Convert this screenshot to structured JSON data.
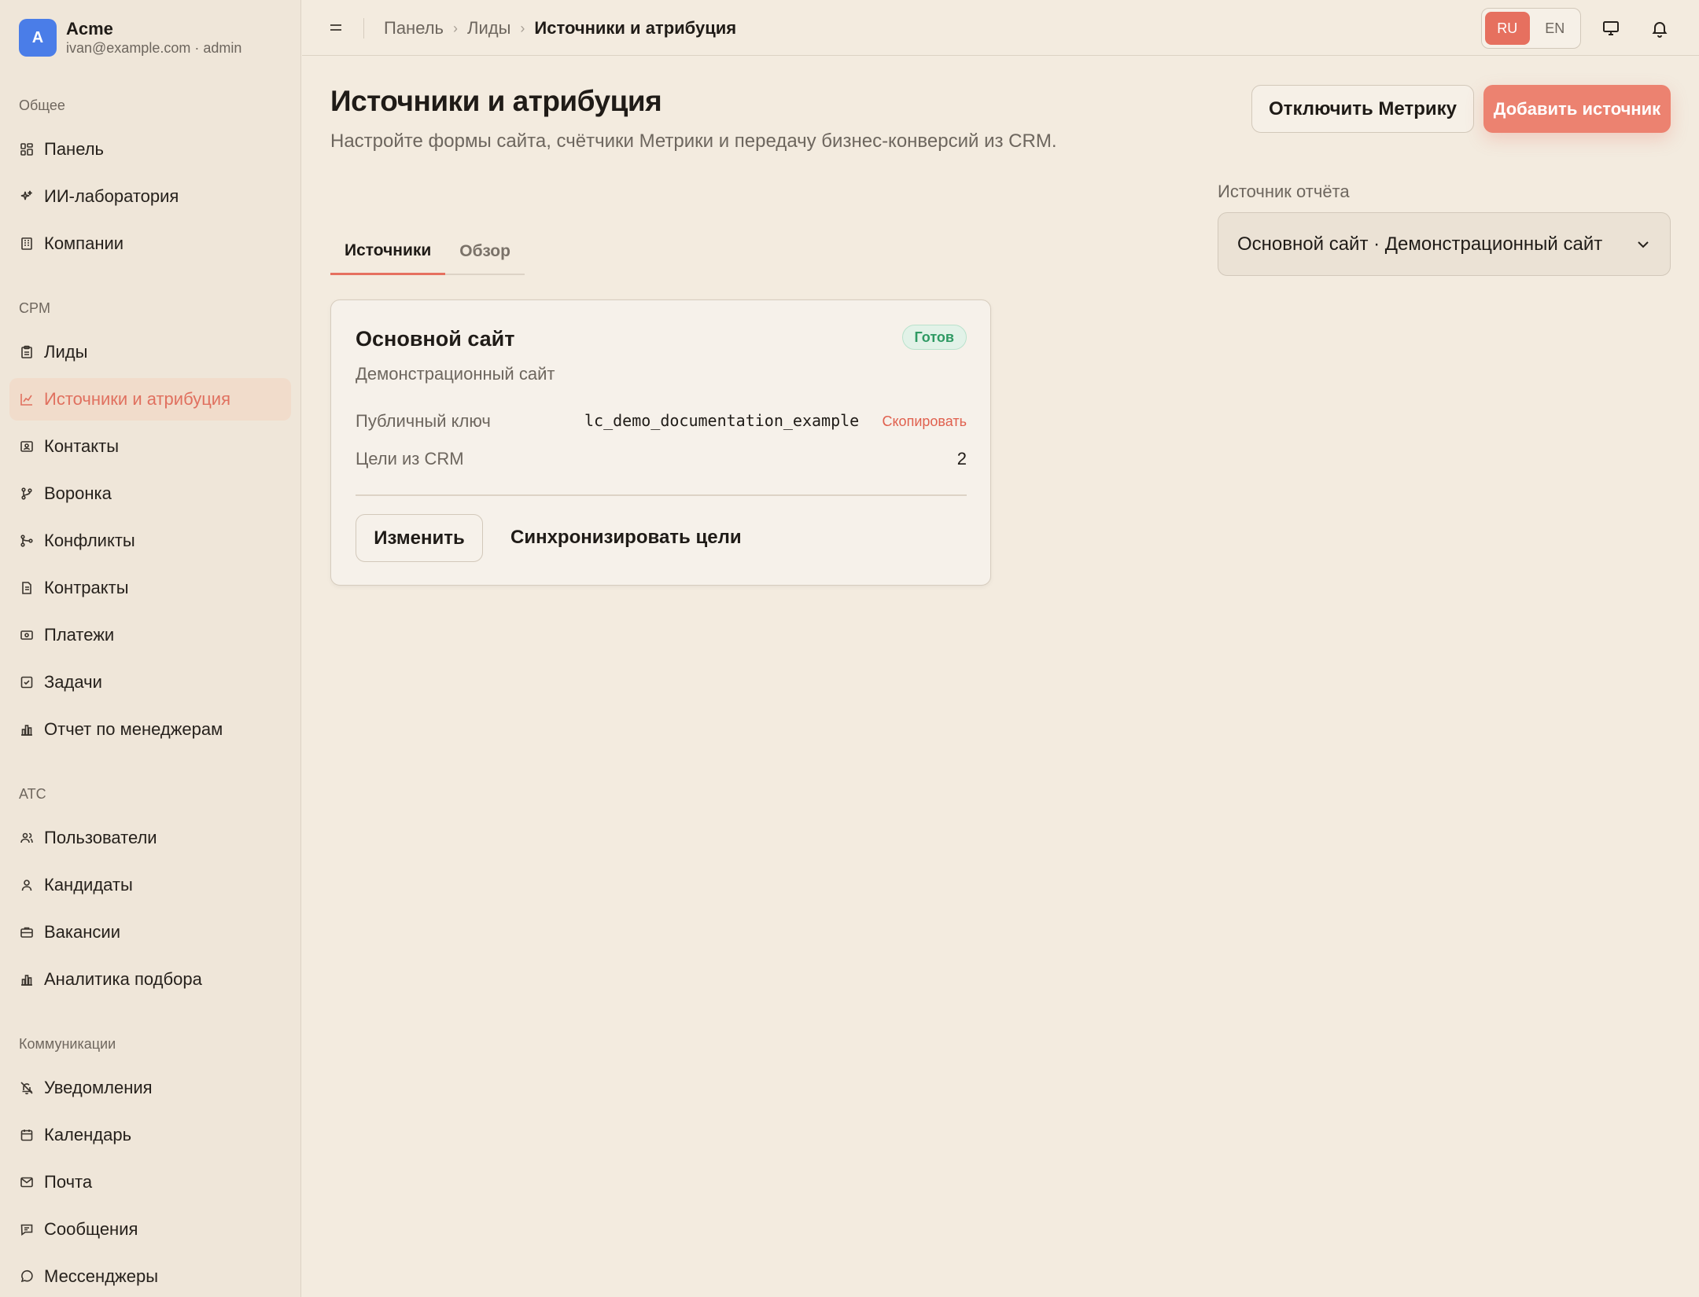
{
  "org": {
    "avatar_letter": "A",
    "name": "Acme",
    "subtitle": "ivan@example.com · admin"
  },
  "sidebar": {
    "sections": [
      {
        "heading": "Общее",
        "items": [
          {
            "label": "Панель",
            "icon": "dashboard-icon"
          },
          {
            "label": "ИИ-лаборатория",
            "icon": "sparkles-icon"
          },
          {
            "label": "Компании",
            "icon": "building-icon"
          }
        ]
      },
      {
        "heading": "CPM",
        "items": [
          {
            "label": "Лиды",
            "icon": "clipboard-icon"
          },
          {
            "label": "Источники и атрибуция",
            "icon": "chart-line-icon",
            "active": true
          },
          {
            "label": "Контакты",
            "icon": "contact-card-icon"
          },
          {
            "label": "Воронка",
            "icon": "git-branch-icon"
          },
          {
            "label": "Конфликты",
            "icon": "git-merge-icon"
          },
          {
            "label": "Контракты",
            "icon": "document-icon"
          },
          {
            "label": "Платежи",
            "icon": "banknote-icon"
          },
          {
            "label": "Задачи",
            "icon": "checkbox-icon"
          },
          {
            "label": "Отчет по менеджерам",
            "icon": "bar-chart-icon"
          }
        ]
      },
      {
        "heading": "АТС",
        "items": [
          {
            "label": "Пользователи",
            "icon": "users-icon"
          },
          {
            "label": "Кандидаты",
            "icon": "user-icon"
          },
          {
            "label": "Вакансии",
            "icon": "briefcase-icon"
          },
          {
            "label": "Аналитика подбора",
            "icon": "bar-chart-icon"
          }
        ]
      },
      {
        "heading": "Коммуникации",
        "items": [
          {
            "label": "Уведомления",
            "icon": "bell-off-icon"
          },
          {
            "label": "Календарь",
            "icon": "calendar-icon"
          },
          {
            "label": "Почта",
            "icon": "mail-icon"
          },
          {
            "label": "Сообщения",
            "icon": "message-square-icon"
          },
          {
            "label": "Мессенджеры",
            "icon": "message-circle-icon"
          }
        ]
      }
    ]
  },
  "topbar": {
    "breadcrumb": [
      "Панель",
      "Лиды",
      "Источники и атрибуция"
    ],
    "lang": {
      "ru": "RU",
      "en": "EN",
      "selected": "RU"
    }
  },
  "page": {
    "title": "Источники и атрибуция",
    "subtitle": "Настройте формы сайта, счётчики Метрики и передачу бизнес-конверсий из CRM.",
    "disable_metrika_label": "Отключить Метрику",
    "add_source_label": "Добавить источник",
    "report_source_label": "Источник отчёта",
    "report_source_value": "Основной сайт · Демонстрационный сайт",
    "tabs": [
      {
        "label": "Источники",
        "active": true
      },
      {
        "label": "Обзор",
        "active": false
      }
    ]
  },
  "source_card": {
    "title": "Основной сайт",
    "status": "Готов",
    "subtitle": "Демонстрационный сайт",
    "public_key_label": "Публичный ключ",
    "public_key_value": "lc_demo_documentation_example",
    "copy_label": "Скопировать",
    "goals_label": "Цели из CRM",
    "goals_value": "2",
    "edit_label": "Изменить",
    "sync_label": "Синхронизировать цели"
  },
  "colors": {
    "accent": "#e6705f",
    "background": "#f3ebdf",
    "sidebar": "#efe6d9",
    "status_green": "#2f9a64",
    "avatar_blue": "#4a7de8"
  }
}
